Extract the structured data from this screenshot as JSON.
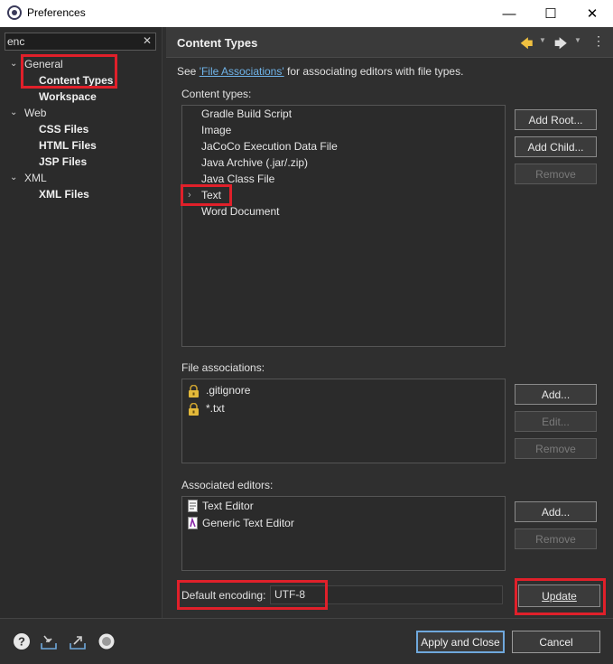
{
  "window": {
    "title": "Preferences"
  },
  "filter": {
    "value": "enc",
    "clear_glyph": "✕"
  },
  "tree": {
    "groups": [
      {
        "label": "General",
        "children": [
          "Content Types",
          "Workspace"
        ]
      },
      {
        "label": "Web",
        "children": [
          "CSS Files",
          "HTML Files",
          "JSP Files"
        ]
      },
      {
        "label": "XML",
        "children": [
          "XML Files"
        ]
      }
    ]
  },
  "header": {
    "title": "Content Types"
  },
  "see": {
    "prefix": "See ",
    "link": "'File Associations'",
    "suffix": " for associating editors with file types."
  },
  "content_types": {
    "label": "Content types:",
    "items": [
      "Gradle Build Script",
      "Image",
      "JaCoCo Execution Data File",
      "Java Archive (.jar/.zip)",
      "Java Class File",
      "Text",
      "Word Document"
    ],
    "buttons": {
      "add_root": "Add Root...",
      "add_child": "Add Child...",
      "remove": "Remove"
    }
  },
  "file_associations": {
    "label": "File associations:",
    "items": [
      ".gitignore",
      "*.txt"
    ],
    "buttons": {
      "add": "Add...",
      "edit": "Edit...",
      "remove": "Remove"
    }
  },
  "associated_editors": {
    "label": "Associated editors:",
    "items": [
      "Text Editor",
      "Generic Text Editor"
    ],
    "buttons": {
      "add": "Add...",
      "remove": "Remove"
    }
  },
  "encoding": {
    "label": "Default encoding:",
    "value": "UTF-8",
    "update": "Update"
  },
  "footer": {
    "apply_close": "Apply and Close",
    "cancel": "Cancel"
  },
  "colors": {
    "highlight": "#e0202a",
    "link": "#6fb3e8",
    "back_arrow": "#f0c040"
  }
}
